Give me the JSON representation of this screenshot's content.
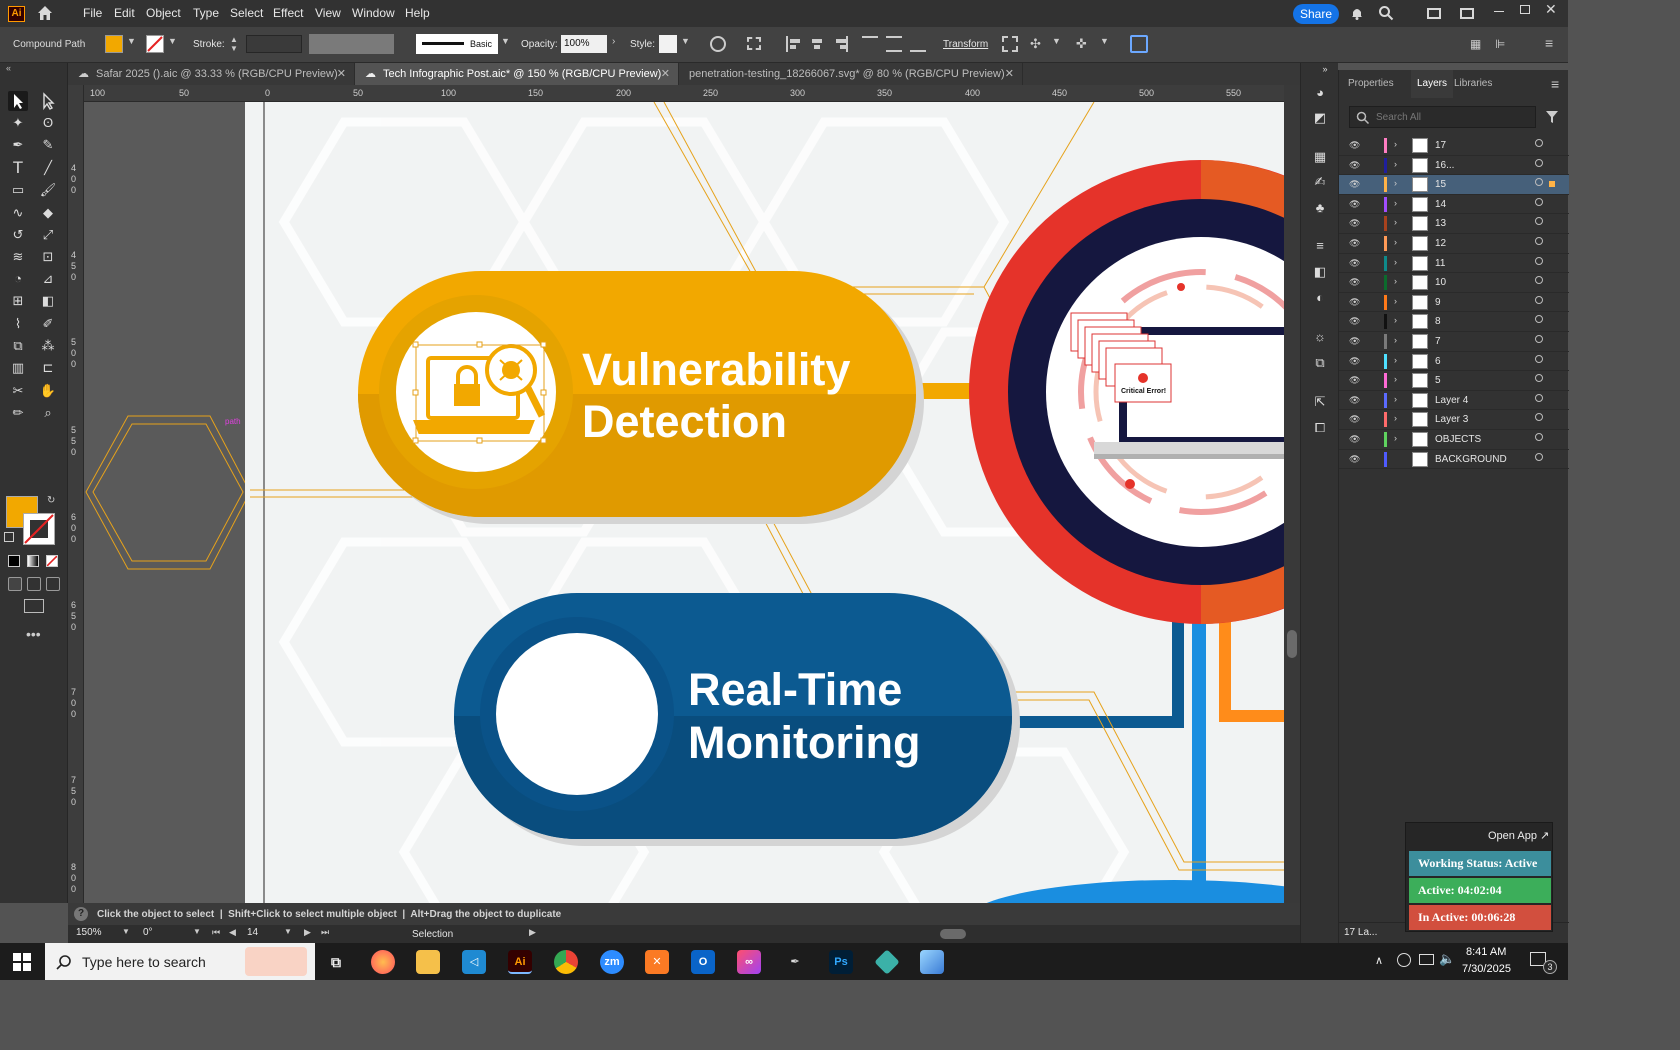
{
  "app": {
    "logo": "Ai",
    "home_icon": "home-icon",
    "accent": "#ff9a00"
  },
  "menu": [
    "File",
    "Edit",
    "Object",
    "Type",
    "Select",
    "Effect",
    "View",
    "Window",
    "Help"
  ],
  "titlebar": {
    "share_label": "Share"
  },
  "control_bar": {
    "selection_type": "Compound Path",
    "fill_color": "#f2a800",
    "stroke_label": "Stroke:",
    "brush_label": "Basic",
    "opacity_label": "Opacity:",
    "opacity_value": "100%",
    "style_label": "Style:",
    "transform_label": "Transform"
  },
  "tabs": [
    {
      "label": "Safar 2025 ().aic @ 33.33 % (RGB/CPU Preview)",
      "active": false
    },
    {
      "label": "Tech Infographic Post.aic* @ 150 % (RGB/CPU Preview)",
      "active": true
    },
    {
      "label": "penetration-testing_18266067.svg* @ 80 % (RGB/CPU Preview)",
      "active": false
    }
  ],
  "ruler": {
    "h_labels": [
      "100",
      "50",
      "0",
      "50",
      "100",
      "150",
      "200",
      "250",
      "300",
      "350",
      "400",
      "450",
      "500",
      "550"
    ],
    "v_labels": [
      "4\n0\n0",
      "4\n5\n0",
      "5\n0\n0",
      "5\n5\n0",
      "6\n0\n0",
      "6\n5\n0",
      "7\n0\n0",
      "7\n5\n0",
      "8\n0\n0"
    ]
  },
  "artboard": {
    "path_hint": "path",
    "card1": {
      "title_line1": "Vulnerability",
      "title_line2": "Detection",
      "color": "#f2a800",
      "dark": "#e09a00"
    },
    "card2": {
      "title_line1": "Real-Time",
      "title_line2": "Monitoring",
      "color": "#0c5a91",
      "dark": "#094d7e"
    },
    "error_label": "Critical Error!",
    "ring_red": "#e5332a",
    "ring_navy": "#15173f"
  },
  "status": {
    "hint": "Click the object to select  |  Shift+Click to select multiple object  |  Alt+Drag the object to duplicate",
    "zoom": "150%",
    "angle": "0°",
    "artboard_num": "14",
    "tool_name": "Selection"
  },
  "panel": {
    "tabs": [
      "Properties",
      "Layers",
      "Libraries"
    ],
    "active_tab": "Layers",
    "search_placeholder": "Search All",
    "layers": [
      {
        "name": "17",
        "color": "#ff7dc2"
      },
      {
        "name": "16...",
        "color": "#1f1f9e"
      },
      {
        "name": "15",
        "color": "#ffb347",
        "selected": true
      },
      {
        "name": "14",
        "color": "#a14dff"
      },
      {
        "name": "13",
        "color": "#a8421d"
      },
      {
        "name": "12",
        "color": "#ff9a57"
      },
      {
        "name": "11",
        "color": "#0e8a8a"
      },
      {
        "name": "10",
        "color": "#0b6b2c"
      },
      {
        "name": "9",
        "color": "#ff7a1a"
      },
      {
        "name": "8",
        "color": "#111111"
      },
      {
        "name": "7",
        "color": "#7a7a7a"
      },
      {
        "name": "6",
        "color": "#4fe0ff"
      },
      {
        "name": "5",
        "color": "#ff6ad5"
      },
      {
        "name": "Layer 4",
        "color": "#5b6bff"
      },
      {
        "name": "Layer 3",
        "color": "#ff6b6b"
      },
      {
        "name": "OBJECTS",
        "color": "#5fd35f"
      },
      {
        "name": "BACKGROUND",
        "color": "#4f5bff"
      }
    ],
    "footer_count": "17 La..."
  },
  "tracker": {
    "open_app_label": "Open App ↗",
    "working_status": "Working Status: Active",
    "active_time": "Active: 04:02:04",
    "inactive_time": "In Active: 00:06:28"
  },
  "taskbar": {
    "search_placeholder": "Type here to search",
    "time": "8:41 AM",
    "date": "7/30/2025",
    "notif_count": "3"
  }
}
